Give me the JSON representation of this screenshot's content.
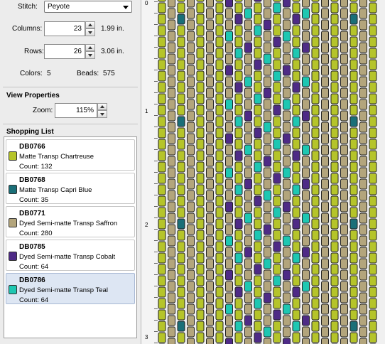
{
  "pattern": {
    "stitch_label": "Stitch:",
    "stitch_value": "Peyote",
    "columns_label": "Columns:",
    "columns_value": "23",
    "columns_inches": "1.99 in.",
    "rows_label": "Rows:",
    "rows_value": "26",
    "rows_inches": "3.06 in.",
    "colors_label": "Colors:",
    "colors_value": "5",
    "beads_label": "Beads:",
    "beads_value": "575"
  },
  "view": {
    "title": "View Properties",
    "zoom_label": "Zoom:",
    "zoom_value": "115%"
  },
  "shopping": {
    "title": "Shopping List",
    "items": [
      {
        "code": "DB0766",
        "name": "Matte Transp Chartreuse",
        "count": "Count: 132",
        "color": "#b5c42a"
      },
      {
        "code": "DB0768",
        "name": "Matte Transp Capri Blue",
        "count": "Count: 35",
        "color": "#1a6f78"
      },
      {
        "code": "DB0771",
        "name": "Dyed Semi-matte Transp Saffron",
        "count": "Count: 280",
        "color": "#b3a57c"
      },
      {
        "code": "DB0785",
        "name": "Dyed Semi-matte Transp Cobalt",
        "count": "Count: 64",
        "color": "#4e2b86"
      },
      {
        "code": "DB0786",
        "name": "Dyed Semi-matte Transp Teal",
        "count": "Count: 64",
        "color": "#1ec7b2"
      }
    ]
  },
  "ruler": {
    "labels": [
      "0",
      "1",
      "2",
      "3"
    ]
  },
  "icons": {
    "stitch_dropdown": "chevron-down-icon",
    "spinner_up": "arrow-up-icon",
    "spinner_down": "arrow-down-icon"
  }
}
